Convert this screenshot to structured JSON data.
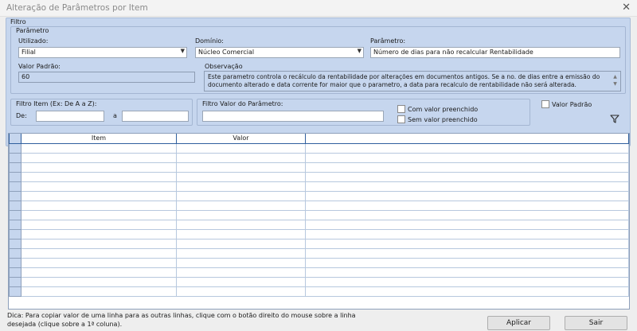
{
  "window": {
    "title": "Alteração de Parâmetros por Item",
    "close_glyph": "✕"
  },
  "filtro": {
    "label": "Filtro",
    "parametro_group": {
      "label": "Parâmetro",
      "utilizado": {
        "label": "Utilizado:",
        "value": "Filial"
      },
      "dominio": {
        "label": "Domínio:",
        "value": "Núcleo Comercial"
      },
      "parametro": {
        "label": "Parâmetro:",
        "value": "Número de dias para não recalcular Rentabilidade"
      },
      "valor_padrao": {
        "label": "Valor Padrão:",
        "value": "60"
      },
      "observacao": {
        "label": "Observação",
        "text": "Este parametro controla o recálculo da rentabilidade por alterações em documentos antigos. Se a no. de dias entre a emissão do documento alterado e data corrente for maior que o parametro, a data para recalculo de rentabilidade não será alterada."
      }
    },
    "filtro_item": {
      "label": "Filtro Item (Ex: De A a Z):",
      "de_label": "De:",
      "de_value": "",
      "a_label": "a",
      "a_value": ""
    },
    "filtro_valor": {
      "label": "Filtro Valor do Parâmetro:",
      "value": "",
      "com_valor_label": "Com valor preenchido",
      "sem_valor_label": "Sem valor preenchido"
    },
    "valor_padrao_check_label": "Valor Padrão",
    "filter_icon": "filter-icon"
  },
  "grid": {
    "columns": [
      "Item",
      "Valor"
    ]
  },
  "footer": {
    "hint": "Dica: Para copiar valor de uma linha para as outras linhas, clique com o botão direito do mouse sobre a linha desejada (clique sobre a 1ª coluna).",
    "apply_label": "Aplicar",
    "exit_label": "Sair"
  },
  "colors": {
    "panel": "#c6d6ee",
    "grid_header_border": "#2f5f9e"
  }
}
